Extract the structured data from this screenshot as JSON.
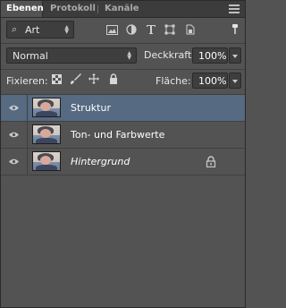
{
  "tabs": [
    {
      "label": "Ebenen",
      "active": true
    },
    {
      "label": "Protokoll",
      "active": false
    },
    {
      "label": "Kanäle",
      "active": false
    }
  ],
  "filter": {
    "kind_label": "Art",
    "icons": [
      "image-filter-icon",
      "adjustment-filter-icon",
      "type-filter-icon",
      "shape-filter-icon",
      "smart-object-filter-icon"
    ]
  },
  "blend": {
    "mode": "Normal",
    "opacity_label": "Deckkraft:",
    "opacity_value": "100%"
  },
  "lock": {
    "label": "Fixieren:",
    "icons": [
      "lock-transparent-pixels-icon",
      "lock-image-pixels-icon",
      "lock-position-icon",
      "lock-all-icon"
    ],
    "fill_label": "Fläche:",
    "fill_value": "100%"
  },
  "layers": [
    {
      "name": "Struktur",
      "selected": true,
      "visible": true,
      "locked": false,
      "italic": false
    },
    {
      "name": "Ton- und Farbwerte",
      "selected": false,
      "visible": true,
      "locked": false,
      "italic": false
    },
    {
      "name": "Hintergrund",
      "selected": false,
      "visible": true,
      "locked": true,
      "italic": true
    }
  ],
  "colors": {
    "panel_bg": "#535353",
    "field_bg": "#3e3e3e",
    "selected_row": "#566a82",
    "tabbar_bg": "#3c3c3c"
  }
}
